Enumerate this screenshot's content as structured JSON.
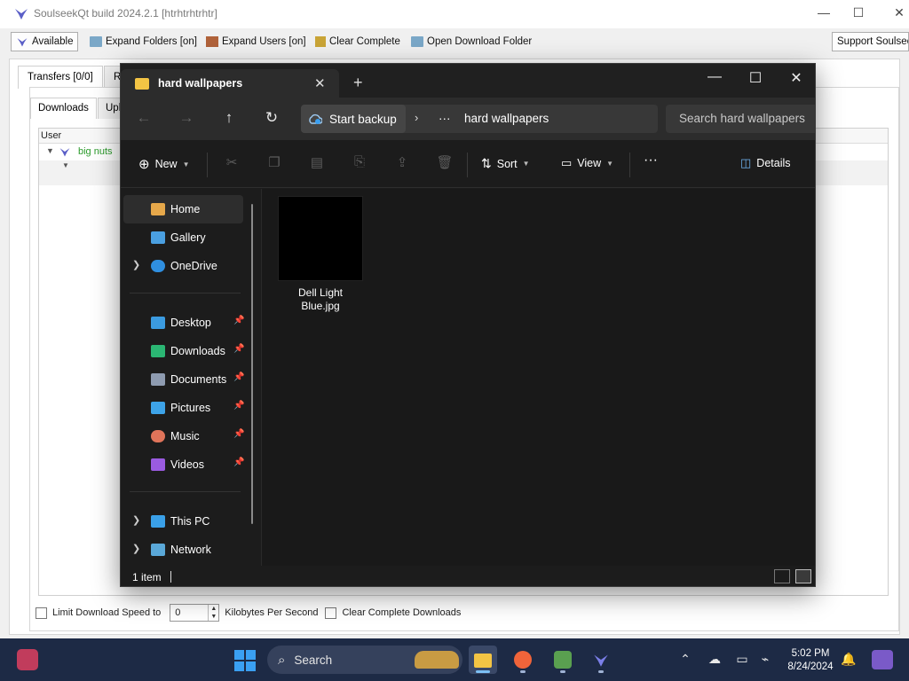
{
  "soulseek": {
    "title": "SoulseekQt build 2024.2.1 [htrhtrhtrhtr]",
    "toolbar": {
      "available": "Available",
      "expand_folders": "Expand Folders [on]",
      "expand_users": "Expand Users [on]",
      "clear_complete": "Clear Complete",
      "open_download_folder": "Open Download Folder",
      "support": "Support Soulseek"
    },
    "tabs": {
      "transfers": "Transfers [0/0]",
      "second": "R"
    },
    "subtabs": {
      "downloads": "Downloads",
      "uploads": "Upl"
    },
    "list": {
      "column_user": "User",
      "row_user": "big nuts"
    },
    "bottom": {
      "limit_label": "Limit Download Speed to",
      "speed_value": "0",
      "unit": "Kilobytes Per Second",
      "clear_label": "Clear Complete Downloads"
    }
  },
  "explorer": {
    "tab_title": "hard wallpapers",
    "breadcrumb_root": "Start backup",
    "breadcrumb_more": "···",
    "breadcrumb_current": "hard wallpapers",
    "search_placeholder": "Search hard wallpapers",
    "commands": {
      "new": "New",
      "sort": "Sort",
      "view": "View",
      "more": "···",
      "details": "Details"
    },
    "sidebar": [
      {
        "label": "Home",
        "icon": "home-icon",
        "selected": true
      },
      {
        "label": "Gallery",
        "icon": "gallery-icon"
      },
      {
        "label": "OneDrive",
        "icon": "cloud-icon",
        "expandable": true
      },
      {
        "label": "Desktop",
        "icon": "desktop-icon",
        "pinned": true
      },
      {
        "label": "Downloads",
        "icon": "download-icon",
        "pinned": true
      },
      {
        "label": "Documents",
        "icon": "document-icon",
        "pinned": true
      },
      {
        "label": "Pictures",
        "icon": "pictures-icon",
        "pinned": true
      },
      {
        "label": "Music",
        "icon": "music-icon",
        "pinned": true
      },
      {
        "label": "Videos",
        "icon": "videos-icon",
        "pinned": true
      },
      {
        "label": "This PC",
        "icon": "computer-icon",
        "expandable": true
      },
      {
        "label": "Network",
        "icon": "network-icon",
        "expandable": true
      }
    ],
    "files": [
      {
        "name_line1": "Dell Light",
        "name_line2": "Blue.jpg"
      }
    ],
    "status": "1 item"
  },
  "taskbar": {
    "search_label": "Search",
    "time": "5:02 PM",
    "date": "8/24/2024"
  },
  "colors": {
    "explorer_bg": "#1c1c1c",
    "folder_yellow": "#f3c444",
    "taskbar_bg": "#1d2a45",
    "windows_blue": "#3aa0f2"
  }
}
